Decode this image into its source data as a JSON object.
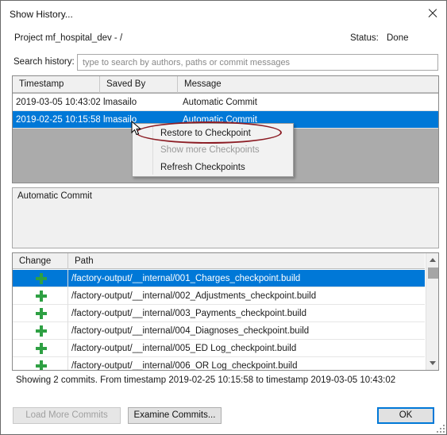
{
  "window": {
    "title": "Show History...",
    "close_label": "close"
  },
  "project": {
    "label": "Project mf_hospital_dev - /"
  },
  "status": {
    "label": "Status:",
    "value": "Done"
  },
  "search": {
    "label": "Search history:",
    "value": "",
    "placeholder": "type to search by authors, paths or commit messages"
  },
  "commits": {
    "columns": {
      "timestamp": "Timestamp",
      "saved_by": "Saved By",
      "message": "Message"
    },
    "rows": [
      {
        "timestamp": "2019-03-05 10:43:02",
        "saved_by": "lmasailo",
        "message": "Automatic Commit",
        "selected": false
      },
      {
        "timestamp": "2019-02-25 10:15:58",
        "saved_by": "lmasailo",
        "message": "Automatic Commit",
        "selected": true
      }
    ]
  },
  "context_menu": {
    "items": [
      {
        "label": "Restore to Checkpoint",
        "enabled": true,
        "highlighted": true
      },
      {
        "label": "Show more Checkpoints",
        "enabled": false
      },
      {
        "label": "Refresh Checkpoints",
        "enabled": true
      }
    ]
  },
  "commit_message": "Automatic Commit",
  "changes": {
    "columns": {
      "change": "Change",
      "path": "Path"
    },
    "rows": [
      {
        "change_icon": "plus-icon",
        "path": "/factory-output/__internal/001_Charges_checkpoint.build",
        "selected": true
      },
      {
        "change_icon": "plus-icon",
        "path": "/factory-output/__internal/002_Adjustments_checkpoint.build",
        "selected": false
      },
      {
        "change_icon": "plus-icon",
        "path": "/factory-output/__internal/003_Payments_checkpoint.build",
        "selected": false
      },
      {
        "change_icon": "plus-icon",
        "path": "/factory-output/__internal/004_Diagnoses_checkpoint.build",
        "selected": false
      },
      {
        "change_icon": "plus-icon",
        "path": "/factory-output/__internal/005_ED Log_checkpoint.build",
        "selected": false
      },
      {
        "change_icon": "plus-icon",
        "path": "/factory-output/__internal/006_OR Log_checkpoint.build",
        "selected": false
      }
    ]
  },
  "summary": "Showing 2 commits. From timestamp 2019-02-25 10:15:58  to timestamp  2019-03-05 10:43:02",
  "buttons": {
    "load_more": "Load More Commits",
    "examine": "Examine Commits...",
    "ok": "OK"
  },
  "colors": {
    "selection": "#0078d7",
    "add": "#2ea043",
    "highlight_ring": "#8c1c24",
    "list_background": "#ababab"
  }
}
